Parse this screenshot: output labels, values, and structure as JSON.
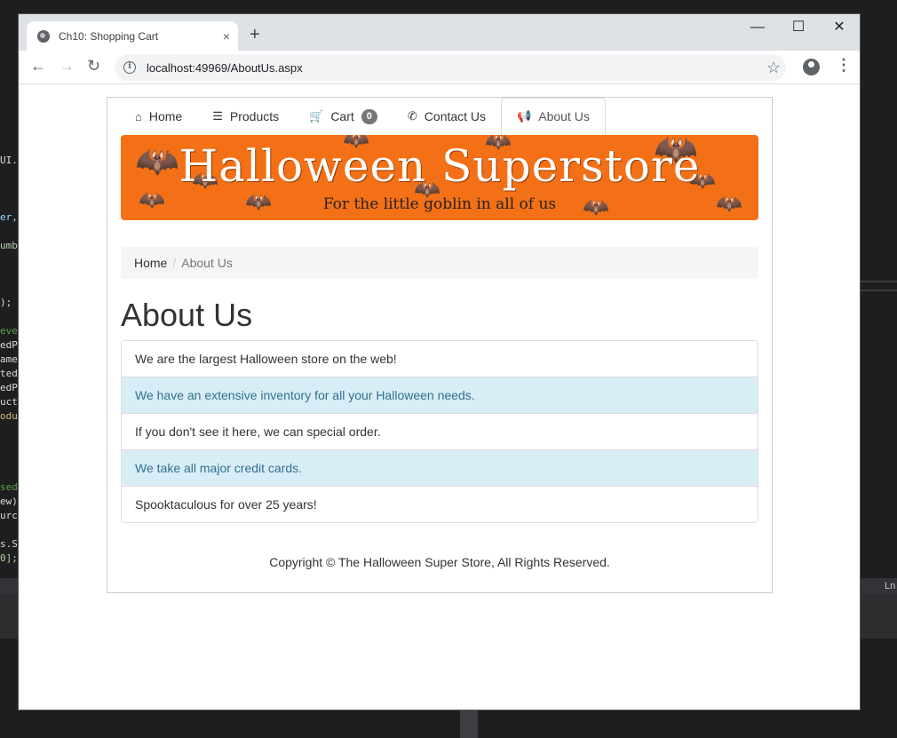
{
  "browser": {
    "tab_title": "Ch10: Shopping Cart",
    "tab_close": "×",
    "new_tab": "+",
    "minimize": "—",
    "maximize": "☐",
    "close": "✕",
    "url": "localhost:49969/AboutUs.aspx",
    "back": "←",
    "forward": "→",
    "reload": "↻",
    "info": "i",
    "star": "☆",
    "menu": "⋮"
  },
  "nav": {
    "items": [
      {
        "label": "Home",
        "icon": "home-icon",
        "glyph": "⌂"
      },
      {
        "label": "Products",
        "icon": "products-icon",
        "glyph": "☰"
      },
      {
        "label": "Cart",
        "icon": "cart-icon",
        "glyph": "🛒",
        "badge": "0"
      },
      {
        "label": "Contact Us",
        "icon": "phone-icon",
        "glyph": "✆"
      },
      {
        "label": "About Us",
        "icon": "megaphone-icon",
        "glyph": "📢",
        "active": true
      }
    ]
  },
  "banner": {
    "headline": "Halloween Superstore",
    "tagline": "For the little goblin in all of us",
    "color": "#f47016"
  },
  "breadcrumb": {
    "home": "Home",
    "separator": "/",
    "current": "About Us"
  },
  "main": {
    "heading": "About Us",
    "items": [
      {
        "text": "We are the largest Halloween store on the web!",
        "style": "default"
      },
      {
        "text": "We have an extensive inventory for all your Halloween needs.",
        "style": "info"
      },
      {
        "text": "If you don't see it here, we can special order.",
        "style": "default"
      },
      {
        "text": "We take all major credit cards.",
        "style": "info"
      },
      {
        "text": "Spooktaculous for over 25 years!",
        "style": "default"
      }
    ]
  },
  "footer": {
    "text": "Copyright © The Halloween Super Store, All Rights Reserved."
  },
  "ide": {
    "status": "Ln"
  }
}
